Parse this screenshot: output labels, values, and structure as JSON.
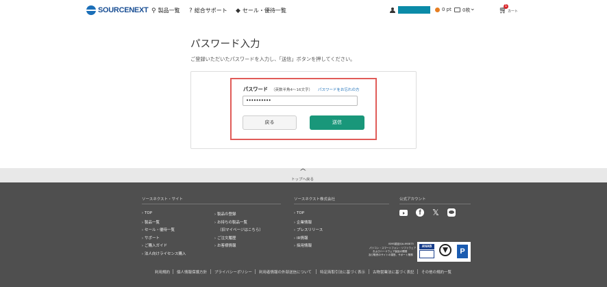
{
  "header": {
    "logo_text": "SOURCENEXT",
    "nav": [
      {
        "label": "製品一覧",
        "icon": "search-icon",
        "glyph": "⚲"
      },
      {
        "label": "総合サポート",
        "icon": "question-icon",
        "glyph": "?"
      },
      {
        "label": "セール・優待一覧",
        "icon": "tag-icon",
        "glyph": "◆"
      }
    ],
    "points": "0 pt",
    "coupons": "0枚",
    "cart_badge": "1",
    "cart_label": "カート"
  },
  "main": {
    "title": "パスワード入力",
    "description": "ご登録いただいたパスワードを入力し、「送信」ボタンを押してください。",
    "password_label": "パスワード",
    "password_hint": "（英数半角4〜16文字）",
    "forgot_link": "パスワードをお忘れの方",
    "password_value": "••••••••••",
    "back_button": "戻る",
    "send_button": "送信",
    "highlight_color": "#e05a57",
    "send_color": "#19977a"
  },
  "totop": {
    "label": "トップへ戻る"
  },
  "footer": {
    "site_heading": "ソースネクスト・サイト",
    "company_heading": "ソースネクスト株式会社",
    "social_heading": "公式アカウント",
    "site_col1": [
      "TOP",
      "製品一覧",
      "セール・優待一覧",
      "サポート",
      "ご購入ガイド",
      "法人向けライセンス購入"
    ],
    "site_col2": [
      "製品の登録",
      "お持ちの製品一覧",
      "ご注文履歴",
      "お客様情報"
    ],
    "site_col2_sub": "（旧マイページはこちら）",
    "company_links": [
      "TOP",
      "企業情報",
      "プレスリリース",
      "IR情報",
      "採用情報"
    ],
    "social_icons": [
      "youtube-icon",
      "facebook-icon",
      "x-icon",
      "line-icon"
    ],
    "cert_id": "ISMS認証JQA-IM0875",
    "cert_lines": [
      "パソコン・スマートフォン・ソフトウェア",
      "およびハードウェア製品の開発",
      "及び販売のサイトの運営、サポート業務"
    ],
    "anab_label": "ANAB",
    "pmark_label": "P",
    "bottom_links": [
      "利用規約",
      "個人情報保護方針",
      "プライバシーポリシー",
      "利用者情報の外部送信について",
      "特定商取引法に基づく表示",
      "古物営業法に基づく表記",
      "その他の規約一覧"
    ],
    "bg_color": "#4f4f4f"
  }
}
